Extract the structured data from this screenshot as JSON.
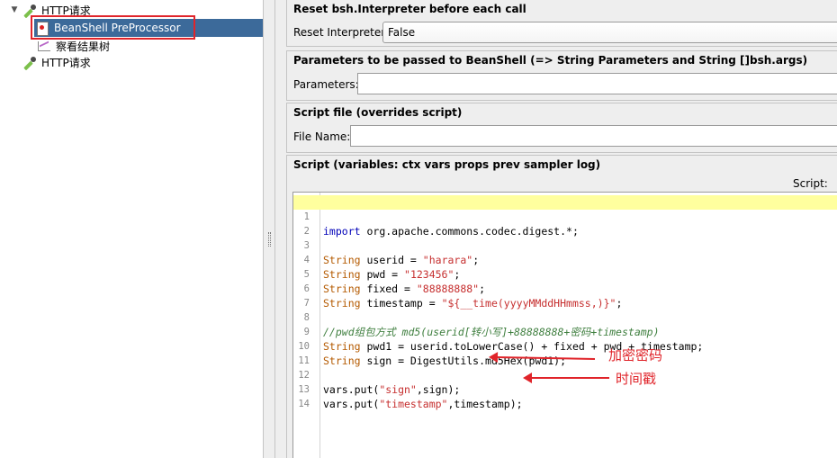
{
  "tree": {
    "items": [
      {
        "label": "HTTP请求",
        "expanded": true
      },
      {
        "label": "BeanShell PreProcessor",
        "selected": true
      },
      {
        "label": "察看结果树"
      },
      {
        "label": "HTTP请求"
      }
    ]
  },
  "sections": {
    "reset": {
      "title": "Reset bsh.Interpreter before each call",
      "label": "Reset Interpreter:",
      "value": "False"
    },
    "params": {
      "title": "Parameters to be passed to BeanShell (=> String Parameters and String []bsh.args)",
      "label": "Parameters:",
      "value": ""
    },
    "file": {
      "title": "Script file (overrides script)",
      "label": "File Name:",
      "value": ""
    },
    "script": {
      "title": "Script (variables: ctx vars props prev sampler log)",
      "label": "Script:"
    }
  },
  "editor": {
    "line_numbers": [
      "1",
      "2",
      "3",
      "4",
      "5",
      "6",
      "7",
      "8",
      "9",
      "10",
      "11",
      "12",
      "13",
      "14"
    ],
    "lines": [
      "import org.apache.commons.codec.digest.*;",
      "",
      "String userid = \"harara\";",
      "String pwd = \"123456\";",
      "String fixed = \"88888888\";",
      "String timestamp = \"${__time(yyyyMMddHHmmss,)}\";",
      "",
      "//pwd组包方式 md5(userid[转小写]+88888888+密码+timestamp)",
      "String pwd1 = userid.toLowerCase() + fixed + pwd + timestamp;",
      "String sign = DigestUtils.md5Hex(pwd1);",
      "",
      "vars.put(\"sign\",sign);",
      "vars.put(\"timestamp\",timestamp);",
      ""
    ]
  },
  "annotations": {
    "note1": "加密密码",
    "note2": "时间戳",
    "color": "#e0242a"
  },
  "colors": {
    "selection": "#3c6a9a",
    "highlight_line": "#ffff9e",
    "panel_bg": "#eeeeee"
  }
}
